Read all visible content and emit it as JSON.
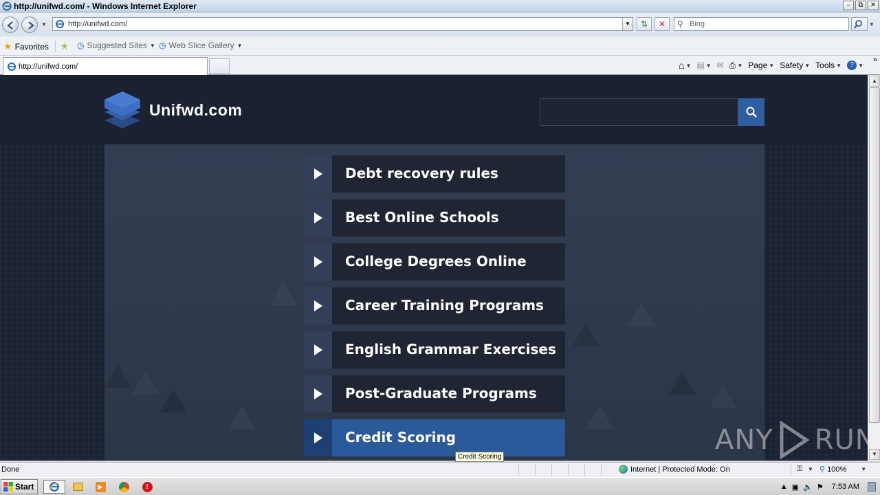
{
  "browser": {
    "window_title": "http://unifwd.com/ - Windows Internet Explorer",
    "address_url": "http://unifwd.com/",
    "search_placeholder": "Bing",
    "favorites_label": "Favorites",
    "suggested_sites_label": "Suggested Sites",
    "web_slice_gallery_label": "Web Slice Gallery",
    "tab_label": "http://unifwd.com/",
    "commands": {
      "page": "Page",
      "safety": "Safety",
      "tools": "Tools"
    }
  },
  "site": {
    "name": "Unifwd.com",
    "search_value": "",
    "menu_items": [
      {
        "label": "Debt recovery rules"
      },
      {
        "label": "Best Online Schools"
      },
      {
        "label": "College Degrees Online"
      },
      {
        "label": "Career Training Programs"
      },
      {
        "label": "English Grammar Exercises"
      },
      {
        "label": "Post-Graduate Programs"
      },
      {
        "label": "Credit Scoring"
      }
    ],
    "tooltip": "Credit Scoring",
    "colors": {
      "header_bg": "#1a2130",
      "panel_bg": "#323d52",
      "item_bg": "#1f2533",
      "active_item_bg": "#2a5a9a",
      "search_button": "#2e5e9e"
    }
  },
  "watermark": {
    "text_left": "ANY",
    "text_right": "RUN"
  },
  "statusbar": {
    "status": "Done",
    "zone": "Internet | Protected Mode: On",
    "zoom": "100%"
  },
  "taskbar": {
    "start_label": "Start",
    "clock": "7:53 AM"
  }
}
